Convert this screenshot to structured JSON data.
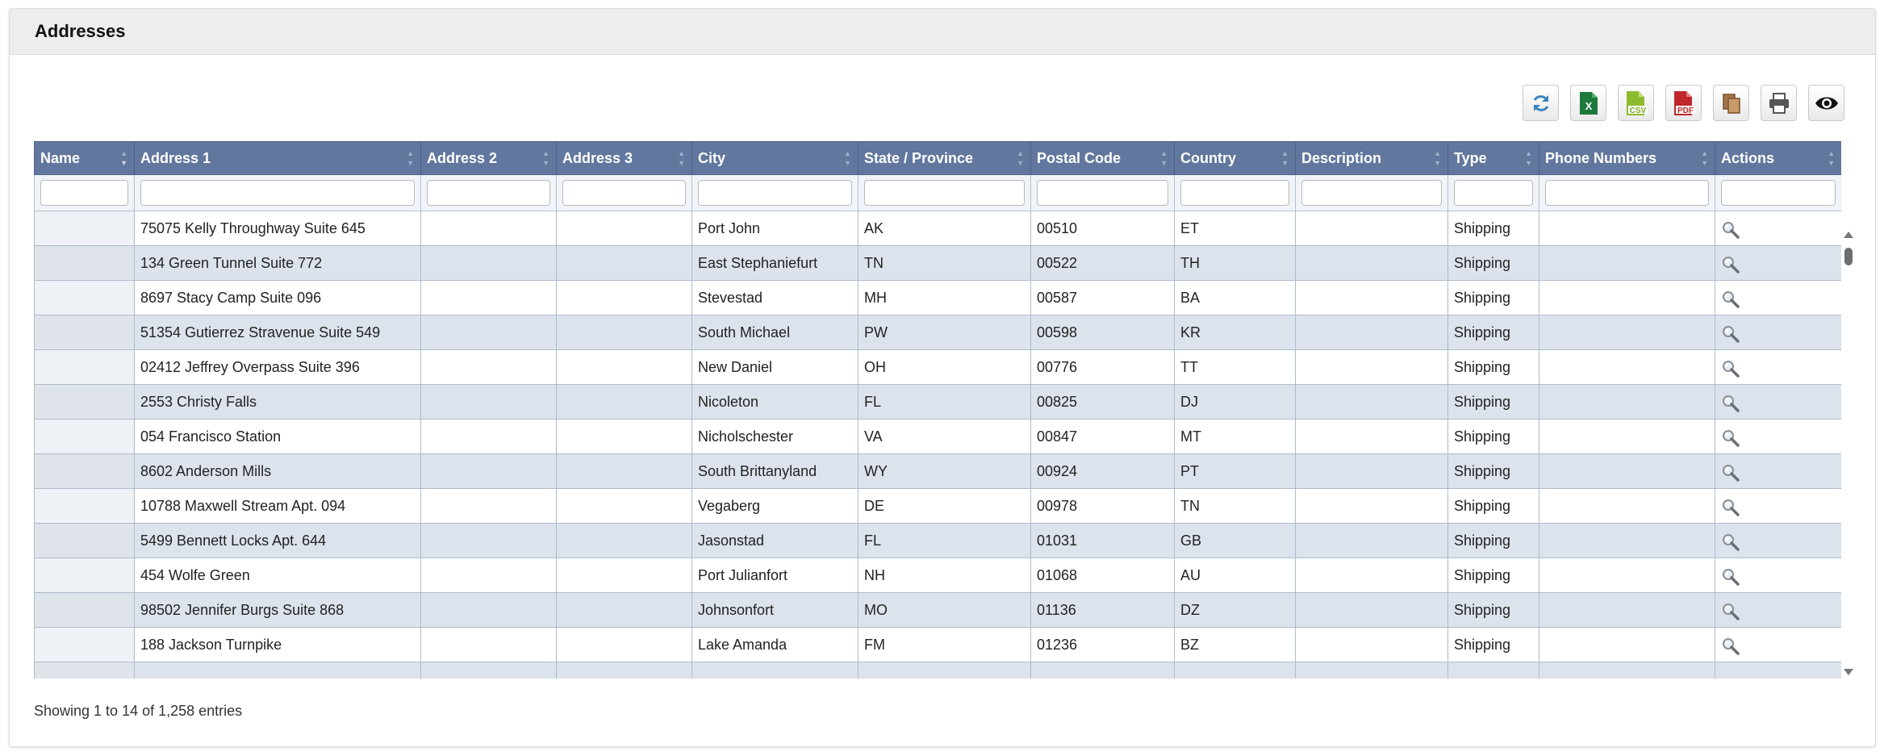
{
  "panel": {
    "title": "Addresses"
  },
  "toolbar": {
    "buttons": [
      {
        "name": "refresh",
        "icon": "refresh-icon"
      },
      {
        "name": "excel",
        "icon": "excel-icon",
        "text": "X"
      },
      {
        "name": "csv",
        "icon": "csv-icon",
        "text": "CSV"
      },
      {
        "name": "pdf",
        "icon": "pdf-icon",
        "text": "PDF"
      },
      {
        "name": "copy",
        "icon": "copy-icon"
      },
      {
        "name": "print",
        "icon": "print-icon"
      },
      {
        "name": "columns",
        "icon": "eye-icon"
      }
    ]
  },
  "table": {
    "columns": [
      "Name",
      "Address 1",
      "Address 2",
      "Address 3",
      "City",
      "State / Province",
      "Postal Code",
      "Country",
      "Description",
      "Type",
      "Phone Numbers",
      "Actions"
    ],
    "rows": [
      {
        "name": "",
        "address1": "75075 Kelly Throughway Suite 645",
        "address2": "",
        "address3": "",
        "city": "Port John",
        "state": "AK",
        "postal": "00510",
        "country": "ET",
        "description": "",
        "type": "Shipping",
        "phones": ""
      },
      {
        "name": "",
        "address1": "134 Green Tunnel Suite 772",
        "address2": "",
        "address3": "",
        "city": "East Stephaniefurt",
        "state": "TN",
        "postal": "00522",
        "country": "TH",
        "description": "",
        "type": "Shipping",
        "phones": ""
      },
      {
        "name": "",
        "address1": "8697 Stacy Camp Suite 096",
        "address2": "",
        "address3": "",
        "city": "Stevestad",
        "state": "MH",
        "postal": "00587",
        "country": "BA",
        "description": "",
        "type": "Shipping",
        "phones": ""
      },
      {
        "name": "",
        "address1": "51354 Gutierrez Stravenue Suite 549",
        "address2": "",
        "address3": "",
        "city": "South Michael",
        "state": "PW",
        "postal": "00598",
        "country": "KR",
        "description": "",
        "type": "Shipping",
        "phones": ""
      },
      {
        "name": "",
        "address1": "02412 Jeffrey Overpass Suite 396",
        "address2": "",
        "address3": "",
        "city": "New Daniel",
        "state": "OH",
        "postal": "00776",
        "country": "TT",
        "description": "",
        "type": "Shipping",
        "phones": ""
      },
      {
        "name": "",
        "address1": "2553 Christy Falls",
        "address2": "",
        "address3": "",
        "city": "Nicoleton",
        "state": "FL",
        "postal": "00825",
        "country": "DJ",
        "description": "",
        "type": "Shipping",
        "phones": ""
      },
      {
        "name": "",
        "address1": "054 Francisco Station",
        "address2": "",
        "address3": "",
        "city": "Nicholschester",
        "state": "VA",
        "postal": "00847",
        "country": "MT",
        "description": "",
        "type": "Shipping",
        "phones": ""
      },
      {
        "name": "",
        "address1": "8602 Anderson Mills",
        "address2": "",
        "address3": "",
        "city": "South Brittanyland",
        "state": "WY",
        "postal": "00924",
        "country": "PT",
        "description": "",
        "type": "Shipping",
        "phones": ""
      },
      {
        "name": "",
        "address1": "10788 Maxwell Stream Apt. 094",
        "address2": "",
        "address3": "",
        "city": "Vegaberg",
        "state": "DE",
        "postal": "00978",
        "country": "TN",
        "description": "",
        "type": "Shipping",
        "phones": ""
      },
      {
        "name": "",
        "address1": "5499 Bennett Locks Apt. 644",
        "address2": "",
        "address3": "",
        "city": "Jasonstad",
        "state": "FL",
        "postal": "01031",
        "country": "GB",
        "description": "",
        "type": "Shipping",
        "phones": ""
      },
      {
        "name": "",
        "address1": "454 Wolfe Green",
        "address2": "",
        "address3": "",
        "city": "Port Julianfort",
        "state": "NH",
        "postal": "01068",
        "country": "AU",
        "description": "",
        "type": "Shipping",
        "phones": ""
      },
      {
        "name": "",
        "address1": "98502 Jennifer Burgs Suite 868",
        "address2": "",
        "address3": "",
        "city": "Johnsonfort",
        "state": "MO",
        "postal": "01136",
        "country": "DZ",
        "description": "",
        "type": "Shipping",
        "phones": ""
      },
      {
        "name": "",
        "address1": "188 Jackson Turnpike",
        "address2": "",
        "address3": "",
        "city": "Lake Amanda",
        "state": "FM",
        "postal": "01236",
        "country": "BZ",
        "description": "",
        "type": "Shipping",
        "phones": ""
      },
      {
        "name": "",
        "address1": "",
        "address2": "",
        "address3": "",
        "city": "",
        "state": "",
        "postal": "",
        "country": "",
        "description": "",
        "type": "",
        "phones": ""
      }
    ]
  },
  "footer": {
    "info": "Showing 1 to 14 of 1,258 entries"
  },
  "colors": {
    "header_bg": "#62779e",
    "row_alt": "#dde3ec",
    "panel_header_bg": "#eceded"
  }
}
